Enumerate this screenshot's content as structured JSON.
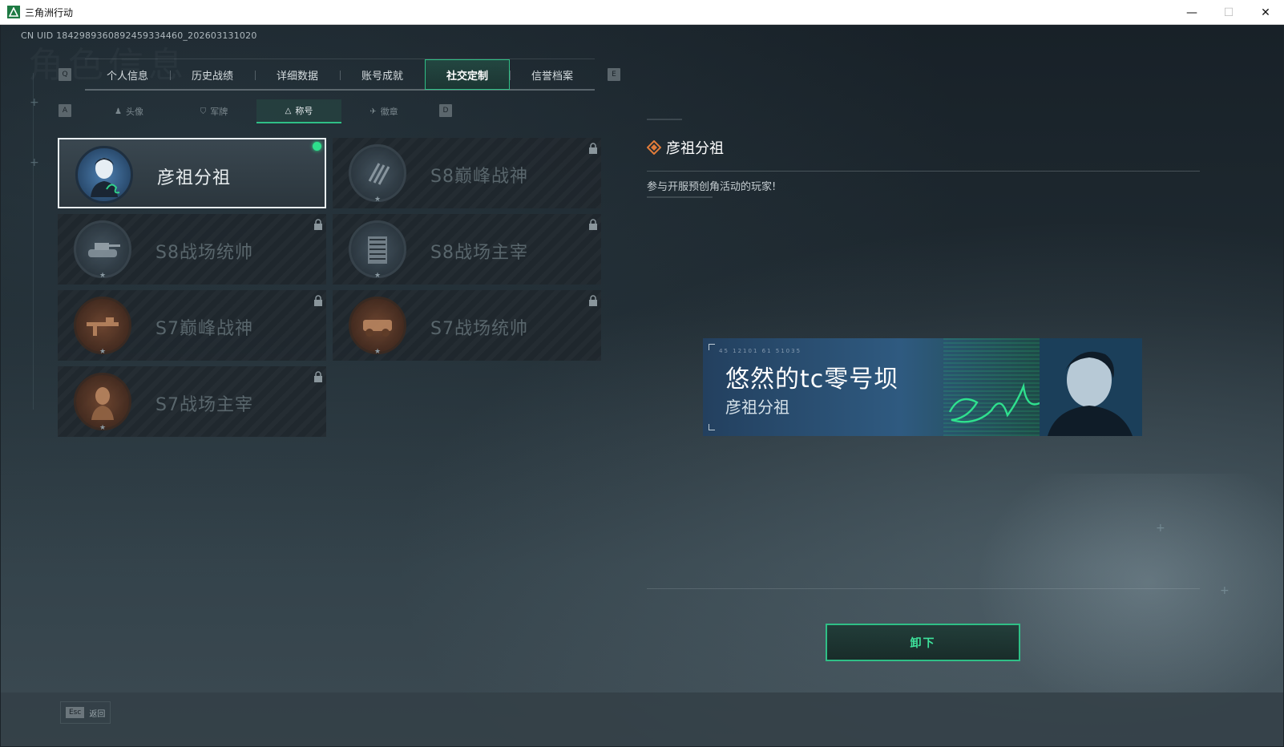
{
  "window": {
    "title": "三角洲行动",
    "minimize": "—",
    "maximize": "☐",
    "close": "✕"
  },
  "uid": "CN UID 1842989360892459334460_202603131020",
  "watermark": "角色信息",
  "keys": {
    "prev_tab": "Q",
    "next_tab": "E",
    "prev_sub": "A",
    "next_sub": "D"
  },
  "main_tabs": [
    {
      "label": "个人信息",
      "active": false
    },
    {
      "label": "历史战绩",
      "active": false
    },
    {
      "label": "详细数据",
      "active": false
    },
    {
      "label": "账号成就",
      "active": false
    },
    {
      "label": "社交定制",
      "active": true
    },
    {
      "label": "信誉档案",
      "active": false
    }
  ],
  "sub_tabs": [
    {
      "label": "头像",
      "icon": "person-icon",
      "glyph": "♟",
      "active": false
    },
    {
      "label": "军牌",
      "icon": "military-badge-icon",
      "glyph": "⛉",
      "active": false
    },
    {
      "label": "称号",
      "icon": "triangle-icon",
      "glyph": "△",
      "active": true
    },
    {
      "label": "徽章",
      "icon": "wings-icon",
      "glyph": "✈",
      "active": false
    }
  ],
  "titles": [
    {
      "label": "彦祖分祖",
      "badge": "portrait-badge",
      "tone": "blue",
      "selected": true,
      "locked": false,
      "equipped": true
    },
    {
      "label": "S8巅峰战神",
      "badge": "blades-badge",
      "tone": "steel",
      "selected": false,
      "locked": true,
      "equipped": false
    },
    {
      "label": "S8战场统帅",
      "badge": "tank-badge",
      "tone": "steel",
      "selected": false,
      "locked": true,
      "equipped": false
    },
    {
      "label": "S8战场主宰",
      "badge": "building-badge",
      "tone": "steel",
      "selected": false,
      "locked": true,
      "equipped": false
    },
    {
      "label": "S7巅峰战神",
      "badge": "rifle-badge",
      "tone": "bronze",
      "selected": false,
      "locked": true,
      "equipped": false
    },
    {
      "label": "S7战场统帅",
      "badge": "vehicle-badge",
      "tone": "bronze",
      "selected": false,
      "locked": true,
      "equipped": false
    },
    {
      "label": "S7战场主宰",
      "badge": "soldier-badge",
      "tone": "bronze",
      "selected": false,
      "locked": true,
      "equipped": false
    }
  ],
  "detail": {
    "name": "彦祖分祖",
    "description": "参与开服预创角活动的玩家!"
  },
  "banner": {
    "code": "45 12101  61 51035",
    "player_name": "悠然的tc零号坝",
    "title": "彦祖分祖"
  },
  "unequip_label": "卸下",
  "footer": {
    "key": "Esc",
    "label": "返回"
  },
  "colors": {
    "accent": "#2fbf86",
    "equipped_dot": "#2ee08c",
    "detail_icon": "#e07b3a"
  }
}
